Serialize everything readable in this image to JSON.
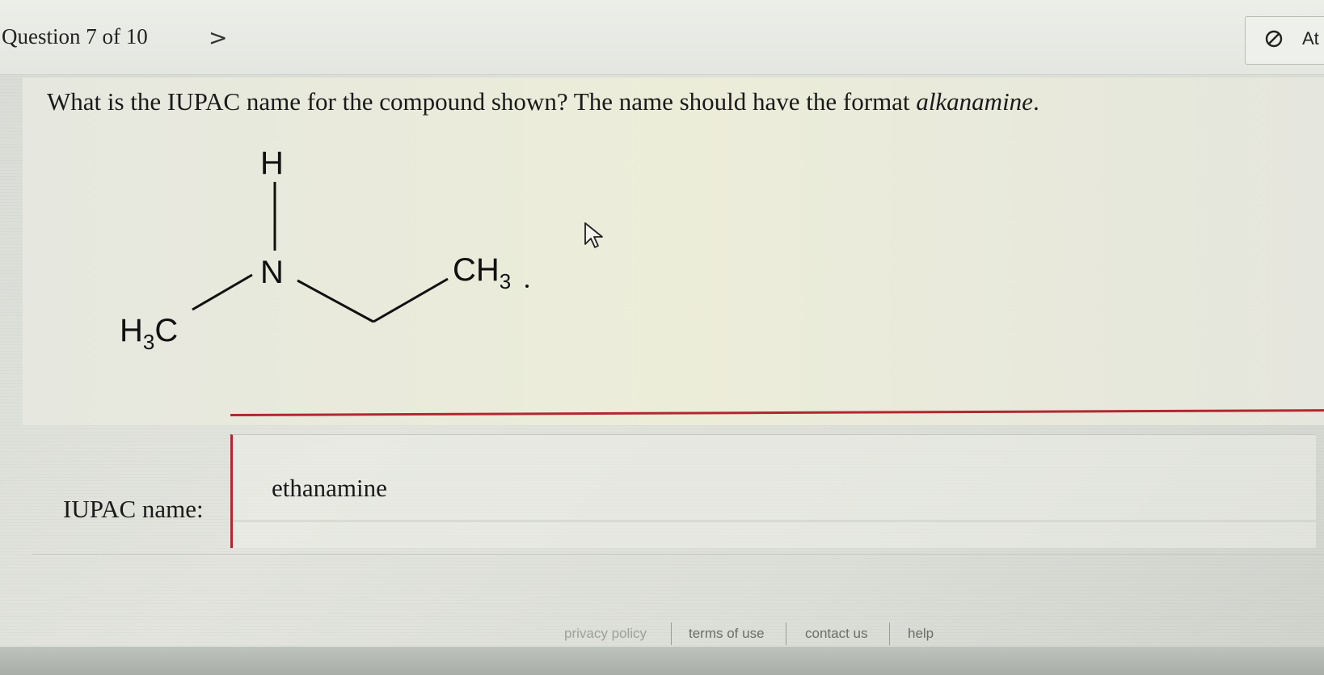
{
  "header": {
    "question_label": "Question 7 of 10",
    "next_chevron": ">",
    "attempt_label": "At"
  },
  "question": {
    "prompt_main": "What is the IUPAC name for the compound shown? The name should have the format ",
    "prompt_format": "alkanamine",
    "prompt_end": "."
  },
  "molecule": {
    "atom_h": "H",
    "atom_n": "N",
    "left_group_main": "H",
    "left_group_sub": "3",
    "left_group_tail": "C",
    "right_group_main": "CH",
    "right_group_sub": "3"
  },
  "answer": {
    "label": "IUPAC name:",
    "value": "ethanamine"
  },
  "footer": {
    "links": [
      "privacy policy",
      "terms of use",
      "contact us",
      "help"
    ]
  },
  "colors": {
    "accent_red": "#b3272f"
  }
}
